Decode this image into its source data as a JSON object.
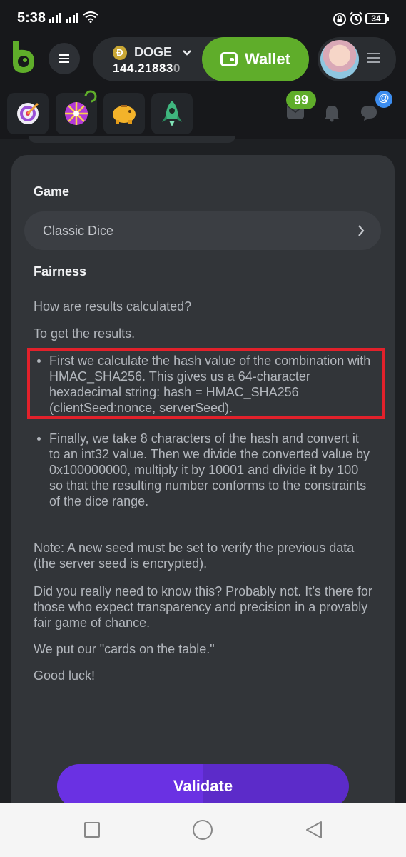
{
  "status_bar": {
    "time": "5:38",
    "battery": "34"
  },
  "header": {
    "coin": {
      "symbol": "Ð",
      "name": "DOGE",
      "balance": "144.21883",
      "balance_tail": "0"
    },
    "wallet_label": "Wallet"
  },
  "toolbar": {
    "messages_count": "99",
    "chat_badge": "@"
  },
  "content": {
    "game_heading": "Game",
    "game_value": "Classic Dice",
    "fairness_heading": "Fairness",
    "question": "How are results calculated?",
    "intro": "To get the results.",
    "bullets": [
      "First we calculate the hash value of the combination with HMAC_SHA256. This gives us a 64-character hexadecimal string: hash = HMAC_SHA256 (clientSeed:nonce, serverSeed).",
      "Finally, we take 8 characters of the hash and convert it to an int32 value. Then we divide the converted value by 0x100000000, multiply it by 10001 and divide it by 100 so that the resulting number conforms to the constraints of the dice range."
    ],
    "note": "Note: A new seed must be set to verify the previous data (the server seed is encrypted).",
    "transparency": "Did you really need to know this? Probably not. It’s there for those who expect transparency and precision in a provably fair game of chance.",
    "cards": "We put our \"cards on the table.\"",
    "luck": "Good luck!",
    "validate_label": "Validate"
  },
  "colors": {
    "accent_green": "#5fad2a",
    "accent_purple": "#6a31e3",
    "highlight_red": "#e2212b",
    "card_bg": "#323539"
  }
}
